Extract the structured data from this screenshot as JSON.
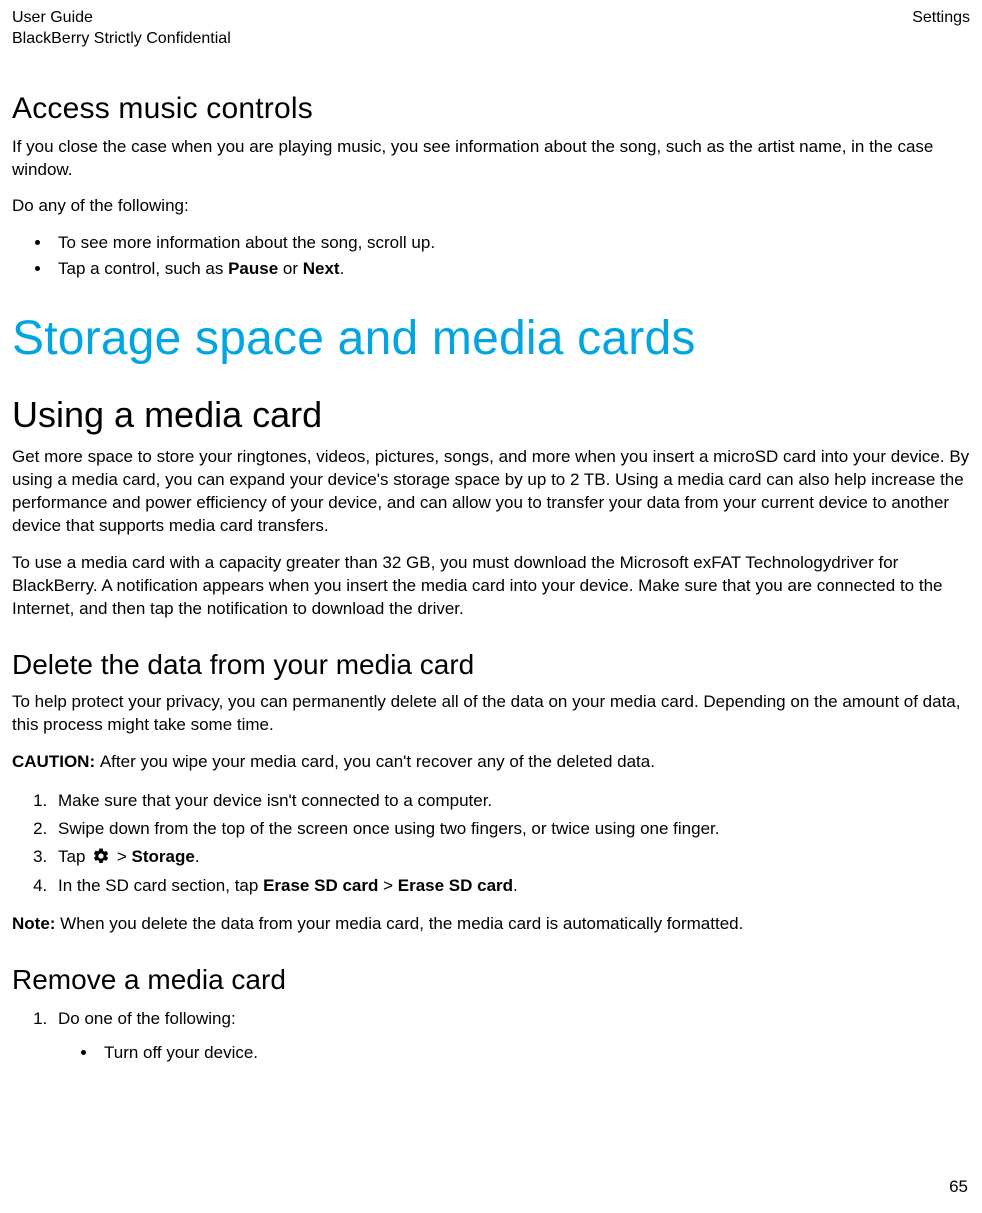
{
  "header": {
    "left1": "User Guide",
    "left2": "BlackBerry Strictly Confidential",
    "right": "Settings"
  },
  "s1": {
    "title": "Access music controls",
    "p1": "If you close the case when you are playing music, you see information about the song, such as the artist name, in the case window.",
    "p2": "Do any of the following:",
    "b1": "To see more information about the song, scroll up.",
    "b2_pre": "Tap a control, such as ",
    "b2_bold1": "Pause",
    "b2_mid": " or ",
    "b2_bold2": "Next",
    "b2_post": "."
  },
  "chapter": "Storage space and media cards",
  "s2": {
    "title": "Using a media card",
    "p1": "Get more space to store your ringtones, videos, pictures, songs, and more when you insert a microSD card into your device. By using a media card, you can expand your device's storage space by up to 2 TB. Using a media card can also help increase the performance and power efficiency of your device, and can allow you to transfer your data from your current device to another device that supports media card transfers.",
    "p2": "To use a media card with a capacity greater than 32 GB, you must download the Microsoft exFAT Technologydriver for BlackBerry. A notification appears when you insert the media card into your device. Make sure that you are connected to the Internet, and then tap the notification to download the driver."
  },
  "s3": {
    "title": "Delete the data from your media card",
    "p1": "To help protect your privacy, you can permanently delete all of the data on your media card. Depending on the amount of data, this process might take some time.",
    "caution_label": "CAUTION: ",
    "caution_text": "After you wipe your media card, you can't recover any of the deleted data.",
    "step1": "Make sure that your device isn't connected to a computer.",
    "step2": "Swipe down from the top of the screen once using two fingers, or twice using one finger.",
    "step3_pre": "Tap ",
    "step3_mid": " > ",
    "step3_bold": "Storage",
    "step3_post": ".",
    "step4_pre": "In the SD card section, tap ",
    "step4_b1": "Erase SD card",
    "step4_mid": " > ",
    "step4_b2": "Erase SD card",
    "step4_post": ".",
    "note_label": "Note: ",
    "note_text": "When you delete the data from your media card, the media card is automatically formatted."
  },
  "s4": {
    "title": "Remove a media card",
    "step1": "Do one of the following:",
    "sub1": "Turn off your device."
  },
  "page_number": "65",
  "icons": {
    "gear": "gear-icon"
  }
}
